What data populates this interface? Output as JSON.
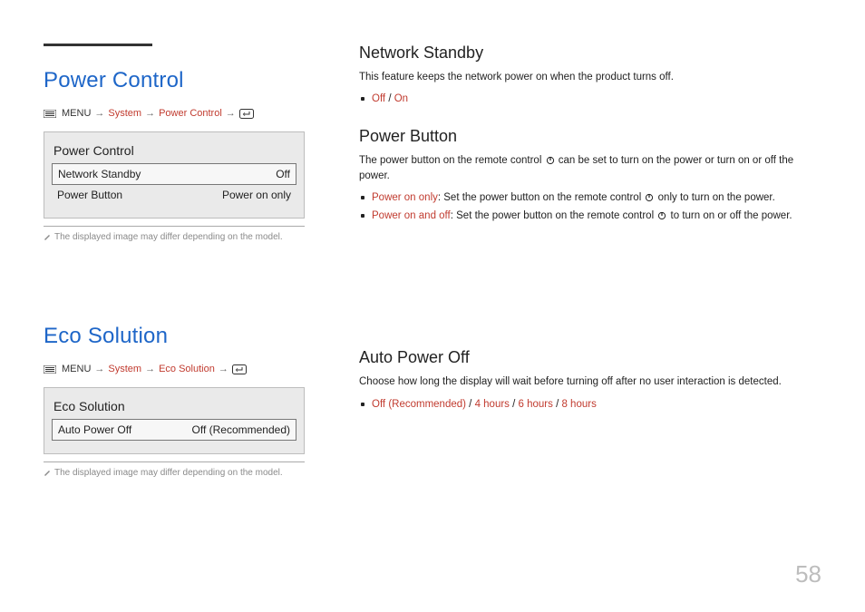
{
  "page_number": "58",
  "breadcrumb": {
    "menu_label": "MENU",
    "system": "System",
    "arrow": "→"
  },
  "power_control": {
    "title": "Power Control",
    "bc_item": "Power Control",
    "panel_title": "Power Control",
    "rows": [
      {
        "label": "Network Standby",
        "value": "Off"
      },
      {
        "label": "Power Button",
        "value": "Power on only"
      }
    ],
    "note": "The displayed image may differ depending on the model."
  },
  "eco_solution": {
    "title": "Eco Solution",
    "bc_item": "Eco Solution",
    "panel_title": "Eco Solution",
    "rows": [
      {
        "label": "Auto Power Off",
        "value": "Off (Recommended)"
      }
    ],
    "note": "The displayed image may differ depending on the model."
  },
  "right": {
    "network_standby": {
      "title": "Network Standby",
      "desc": "This feature keeps the network power on when the product turns off.",
      "options": {
        "off": "Off",
        "sep": " / ",
        "on": "On"
      }
    },
    "power_button": {
      "title": "Power Button",
      "desc_pre": "The power button on the remote control ",
      "desc_post": " can be set to turn on the power or turn on or off the power.",
      "opt1_label": "Power on only",
      "opt1_pre": ": Set the power button on the remote control ",
      "opt1_post": " only to turn on the power.",
      "opt2_label": "Power on and off",
      "opt2_pre": ": Set the power button on the remote control ",
      "opt2_post": " to turn on or off the power."
    },
    "auto_power_off": {
      "title": "Auto Power Off",
      "desc": "Choose how long the display will wait before turning off after no user interaction is detected.",
      "options": {
        "off": "Off (Recommended)",
        "h4": "4 hours",
        "h6": "6 hours",
        "h8": "8 hours",
        "sep": " / "
      }
    }
  }
}
